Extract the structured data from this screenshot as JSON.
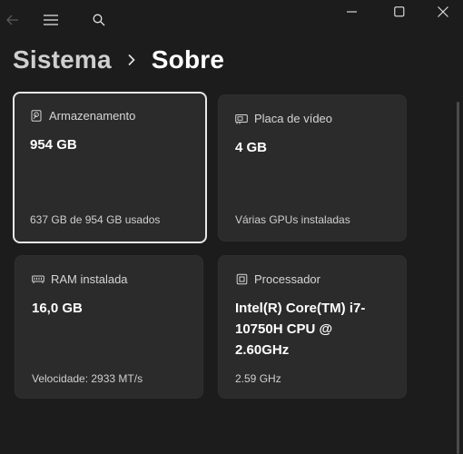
{
  "titlebar": {
    "back_icon": "arrow-left-icon",
    "menu_icon": "hamburger-icon",
    "search_icon": "search-icon",
    "minimize_icon": "minimize-icon",
    "maximize_icon": "maximize-icon",
    "close_icon": "close-icon"
  },
  "breadcrumb": {
    "parent": "Sistema",
    "separator_icon": "chevron-right-icon",
    "current": "Sobre"
  },
  "cards": {
    "storage": {
      "icon": "storage-drive-icon",
      "title": "Armazenamento",
      "value": "954 GB",
      "detail": "637 GB de 954 GB usados"
    },
    "gpu": {
      "icon": "gpu-card-icon",
      "title": "Placa de vídeo",
      "value": "4 GB",
      "detail": "Várias GPUs instaladas"
    },
    "ram": {
      "icon": "ram-module-icon",
      "title": "RAM instalada",
      "value": "16,0 GB",
      "detail": "Velocidade: 2933 MT/s"
    },
    "cpu": {
      "icon": "processor-chip-icon",
      "title": "Processador",
      "value": "Intel(R) Core(TM) i7-10750H CPU @ 2.60GHz",
      "detail": "2.59 GHz"
    }
  },
  "colors": {
    "background": "#1c1c1c",
    "card": "#2b2b2b",
    "selected_border": "#e8e8e8"
  }
}
